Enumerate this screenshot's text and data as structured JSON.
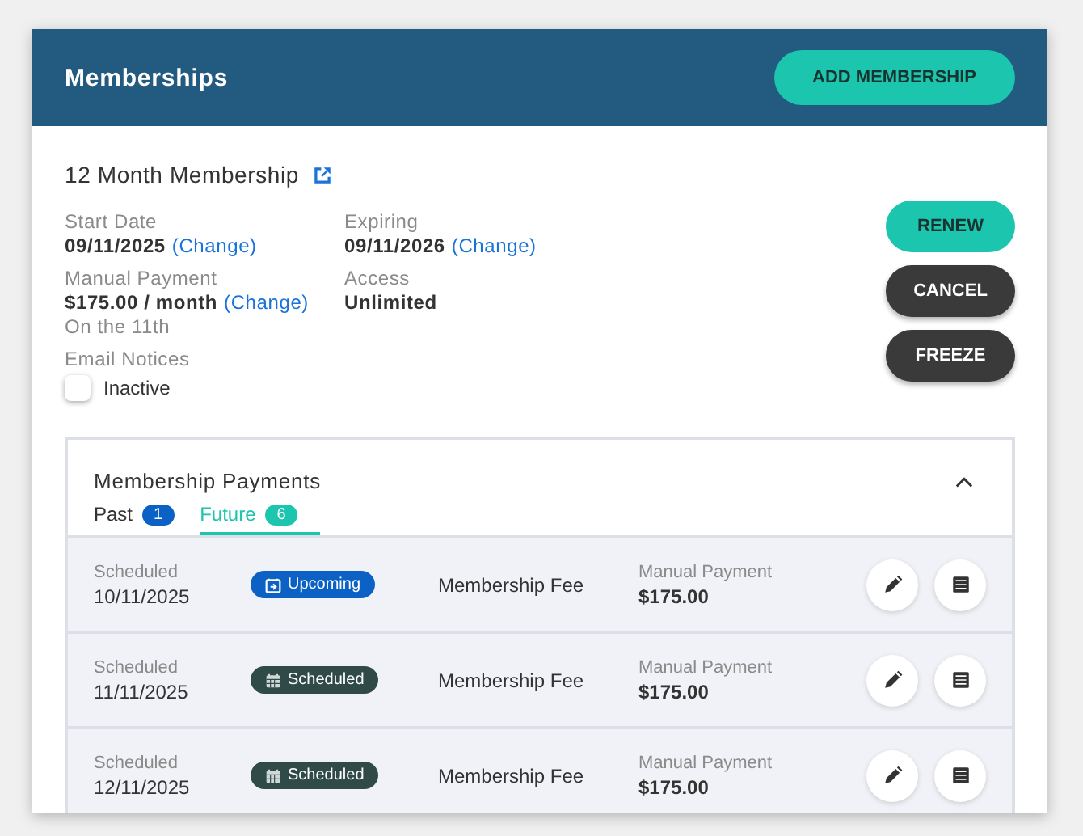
{
  "header": {
    "title": "Memberships",
    "button": "ADD MEMBERSHIP"
  },
  "membership": {
    "name": "12 Month Membership",
    "fields": [
      {
        "label": "Start Date",
        "value": "09/11/2025",
        "link": "(Change)"
      },
      {
        "label": "Expiring",
        "value": "09/11/2026",
        "link": "(Change)"
      },
      {
        "label": "Manual Payment",
        "value": "$175.00 / month",
        "link": "(Change)",
        "note": "On the 11th"
      },
      {
        "label": "Access",
        "value": "Unlimited"
      }
    ],
    "email_notices": {
      "label": "Email Notices",
      "checkbox_label": "Inactive",
      "checked": false
    },
    "actions": [
      {
        "label": "RENEW",
        "kind": "primary"
      },
      {
        "label": "CANCEL",
        "kind": "dark"
      },
      {
        "label": "FREEZE",
        "kind": "dark"
      }
    ]
  },
  "payments": {
    "title": "Membership Payments",
    "expanded": true,
    "tabs": [
      {
        "label": "Past",
        "count": "1",
        "selected": false
      },
      {
        "label": "Future",
        "count": "6",
        "selected": true
      }
    ],
    "rows": [
      {
        "date_label": "Scheduled",
        "date": "10/11/2025",
        "status": "Upcoming",
        "kind": "upcoming",
        "description": "Membership Fee",
        "method": "Manual Payment",
        "amount": "$175.00"
      },
      {
        "date_label": "Scheduled",
        "date": "11/11/2025",
        "status": "Scheduled",
        "kind": "scheduled",
        "description": "Membership Fee",
        "method": "Manual Payment",
        "amount": "$175.00"
      },
      {
        "date_label": "Scheduled",
        "date": "12/11/2025",
        "status": "Scheduled",
        "kind": "scheduled",
        "description": "Membership Fee",
        "method": "Manual Payment",
        "amount": "$175.00"
      }
    ]
  }
}
